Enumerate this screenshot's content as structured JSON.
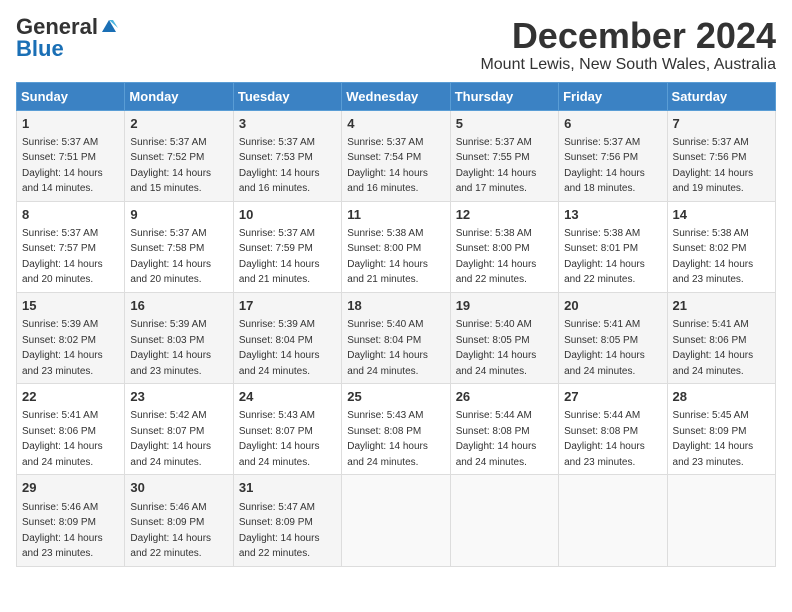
{
  "logo": {
    "general": "General",
    "blue": "Blue"
  },
  "title": {
    "month": "December 2024",
    "location": "Mount Lewis, New South Wales, Australia"
  },
  "calendar": {
    "headers": [
      "Sunday",
      "Monday",
      "Tuesday",
      "Wednesday",
      "Thursday",
      "Friday",
      "Saturday"
    ],
    "rows": [
      [
        {
          "day": "1",
          "sunrise": "5:37 AM",
          "sunset": "7:51 PM",
          "daylight": "14 hours and 14 minutes."
        },
        {
          "day": "2",
          "sunrise": "5:37 AM",
          "sunset": "7:52 PM",
          "daylight": "14 hours and 15 minutes."
        },
        {
          "day": "3",
          "sunrise": "5:37 AM",
          "sunset": "7:53 PM",
          "daylight": "14 hours and 16 minutes."
        },
        {
          "day": "4",
          "sunrise": "5:37 AM",
          "sunset": "7:54 PM",
          "daylight": "14 hours and 16 minutes."
        },
        {
          "day": "5",
          "sunrise": "5:37 AM",
          "sunset": "7:55 PM",
          "daylight": "14 hours and 17 minutes."
        },
        {
          "day": "6",
          "sunrise": "5:37 AM",
          "sunset": "7:56 PM",
          "daylight": "14 hours and 18 minutes."
        },
        {
          "day": "7",
          "sunrise": "5:37 AM",
          "sunset": "7:56 PM",
          "daylight": "14 hours and 19 minutes."
        }
      ],
      [
        {
          "day": "8",
          "sunrise": "5:37 AM",
          "sunset": "7:57 PM",
          "daylight": "14 hours and 20 minutes."
        },
        {
          "day": "9",
          "sunrise": "5:37 AM",
          "sunset": "7:58 PM",
          "daylight": "14 hours and 20 minutes."
        },
        {
          "day": "10",
          "sunrise": "5:37 AM",
          "sunset": "7:59 PM",
          "daylight": "14 hours and 21 minutes."
        },
        {
          "day": "11",
          "sunrise": "5:38 AM",
          "sunset": "8:00 PM",
          "daylight": "14 hours and 21 minutes."
        },
        {
          "day": "12",
          "sunrise": "5:38 AM",
          "sunset": "8:00 PM",
          "daylight": "14 hours and 22 minutes."
        },
        {
          "day": "13",
          "sunrise": "5:38 AM",
          "sunset": "8:01 PM",
          "daylight": "14 hours and 22 minutes."
        },
        {
          "day": "14",
          "sunrise": "5:38 AM",
          "sunset": "8:02 PM",
          "daylight": "14 hours and 23 minutes."
        }
      ],
      [
        {
          "day": "15",
          "sunrise": "5:39 AM",
          "sunset": "8:02 PM",
          "daylight": "14 hours and 23 minutes."
        },
        {
          "day": "16",
          "sunrise": "5:39 AM",
          "sunset": "8:03 PM",
          "daylight": "14 hours and 23 minutes."
        },
        {
          "day": "17",
          "sunrise": "5:39 AM",
          "sunset": "8:04 PM",
          "daylight": "14 hours and 24 minutes."
        },
        {
          "day": "18",
          "sunrise": "5:40 AM",
          "sunset": "8:04 PM",
          "daylight": "14 hours and 24 minutes."
        },
        {
          "day": "19",
          "sunrise": "5:40 AM",
          "sunset": "8:05 PM",
          "daylight": "14 hours and 24 minutes."
        },
        {
          "day": "20",
          "sunrise": "5:41 AM",
          "sunset": "8:05 PM",
          "daylight": "14 hours and 24 minutes."
        },
        {
          "day": "21",
          "sunrise": "5:41 AM",
          "sunset": "8:06 PM",
          "daylight": "14 hours and 24 minutes."
        }
      ],
      [
        {
          "day": "22",
          "sunrise": "5:41 AM",
          "sunset": "8:06 PM",
          "daylight": "14 hours and 24 minutes."
        },
        {
          "day": "23",
          "sunrise": "5:42 AM",
          "sunset": "8:07 PM",
          "daylight": "14 hours and 24 minutes."
        },
        {
          "day": "24",
          "sunrise": "5:43 AM",
          "sunset": "8:07 PM",
          "daylight": "14 hours and 24 minutes."
        },
        {
          "day": "25",
          "sunrise": "5:43 AM",
          "sunset": "8:08 PM",
          "daylight": "14 hours and 24 minutes."
        },
        {
          "day": "26",
          "sunrise": "5:44 AM",
          "sunset": "8:08 PM",
          "daylight": "14 hours and 24 minutes."
        },
        {
          "day": "27",
          "sunrise": "5:44 AM",
          "sunset": "8:08 PM",
          "daylight": "14 hours and 23 minutes."
        },
        {
          "day": "28",
          "sunrise": "5:45 AM",
          "sunset": "8:09 PM",
          "daylight": "14 hours and 23 minutes."
        }
      ],
      [
        {
          "day": "29",
          "sunrise": "5:46 AM",
          "sunset": "8:09 PM",
          "daylight": "14 hours and 23 minutes."
        },
        {
          "day": "30",
          "sunrise": "5:46 AM",
          "sunset": "8:09 PM",
          "daylight": "14 hours and 22 minutes."
        },
        {
          "day": "31",
          "sunrise": "5:47 AM",
          "sunset": "8:09 PM",
          "daylight": "14 hours and 22 minutes."
        },
        null,
        null,
        null,
        null
      ]
    ]
  }
}
